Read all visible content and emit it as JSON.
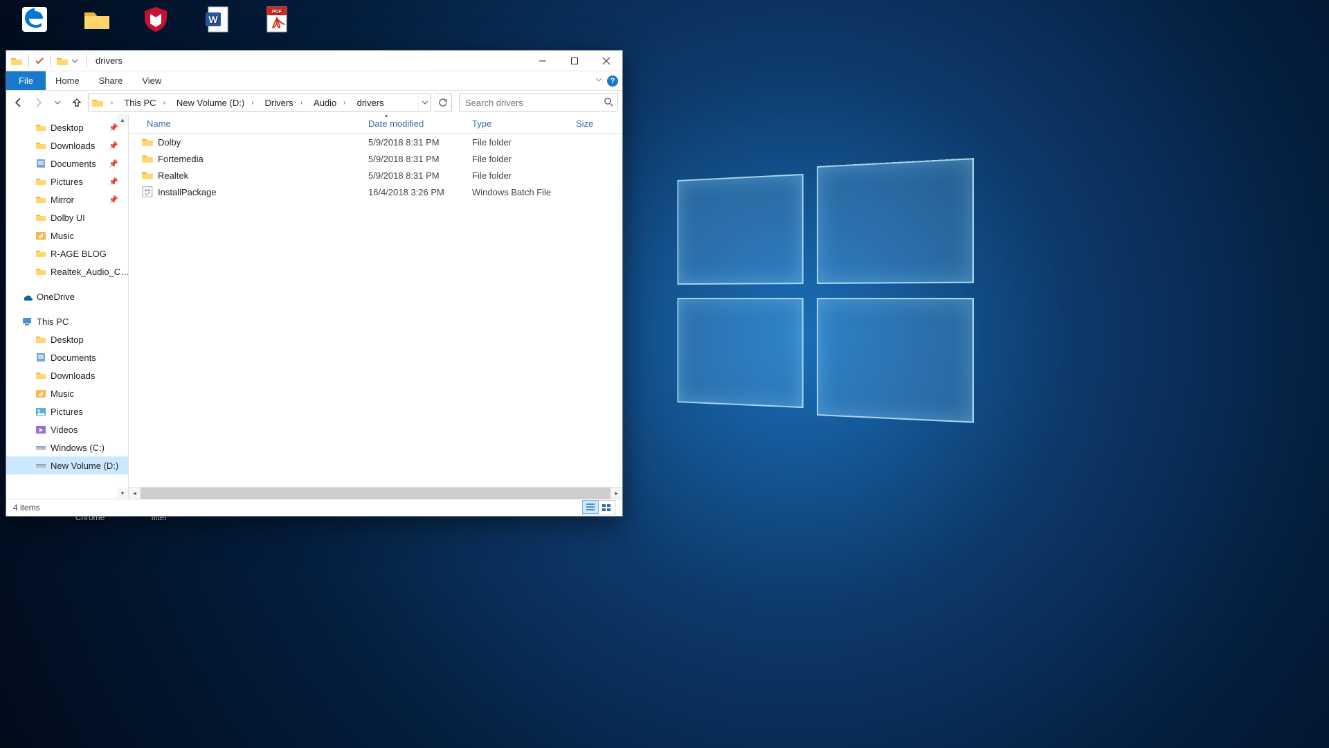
{
  "desktop": {
    "icons": [
      {
        "label": "",
        "kind": "edge"
      },
      {
        "label": "",
        "kind": "folder"
      },
      {
        "label": "",
        "kind": "mcafee"
      },
      {
        "label": "",
        "kind": "word"
      },
      {
        "label": "",
        "kind": "pdf"
      }
    ],
    "bottom_labels": [
      "Chrome",
      "filter"
    ]
  },
  "window": {
    "title": "drivers",
    "tabs": {
      "file": "File",
      "home": "Home",
      "share": "Share",
      "view": "View"
    },
    "help": "?",
    "breadcrumb": [
      "This PC",
      "New Volume (D:)",
      "Drivers",
      "Audio",
      "drivers"
    ],
    "search_placeholder": "Search drivers",
    "columns": {
      "name": "Name",
      "date": "Date modified",
      "type": "Type",
      "size": "Size"
    },
    "rows": [
      {
        "name": "Dolby",
        "date": "5/9/2018 8:31 PM",
        "type": "File folder",
        "icon": "folder"
      },
      {
        "name": "Fortemedia",
        "date": "5/9/2018 8:31 PM",
        "type": "File folder",
        "icon": "folder"
      },
      {
        "name": "Realtek",
        "date": "5/9/2018 8:31 PM",
        "type": "File folder",
        "icon": "folder"
      },
      {
        "name": "InstallPackage",
        "date": "16/4/2018 3:26 PM",
        "type": "Windows Batch File",
        "icon": "batch"
      }
    ],
    "nav": {
      "quick": [
        {
          "label": "Desktop",
          "icon": "folder",
          "pinned": true
        },
        {
          "label": "Downloads",
          "icon": "folder",
          "pinned": true
        },
        {
          "label": "Documents",
          "icon": "library",
          "pinned": true
        },
        {
          "label": "Pictures",
          "icon": "folder",
          "pinned": true
        },
        {
          "label": "Mirror",
          "icon": "folder",
          "pinned": true
        },
        {
          "label": "Dolby UI",
          "icon": "folder",
          "pinned": false
        },
        {
          "label": "Music",
          "icon": "music",
          "pinned": false
        },
        {
          "label": "R-AGE BLOG",
          "icon": "folder",
          "pinned": false
        },
        {
          "label": "Realtek_Audio_C…",
          "icon": "folder",
          "pinned": false
        }
      ],
      "onedrive": "OneDrive",
      "thispc": "This PC",
      "thispc_children": [
        {
          "label": "Desktop",
          "icon": "folder"
        },
        {
          "label": "Documents",
          "icon": "library"
        },
        {
          "label": "Downloads",
          "icon": "folder"
        },
        {
          "label": "Music",
          "icon": "music"
        },
        {
          "label": "Pictures",
          "icon": "pictures"
        },
        {
          "label": "Videos",
          "icon": "videos"
        },
        {
          "label": "Windows (C:)",
          "icon": "drive"
        },
        {
          "label": "New Volume (D:)",
          "icon": "drive",
          "selected": true
        }
      ]
    },
    "status": "4 items"
  }
}
